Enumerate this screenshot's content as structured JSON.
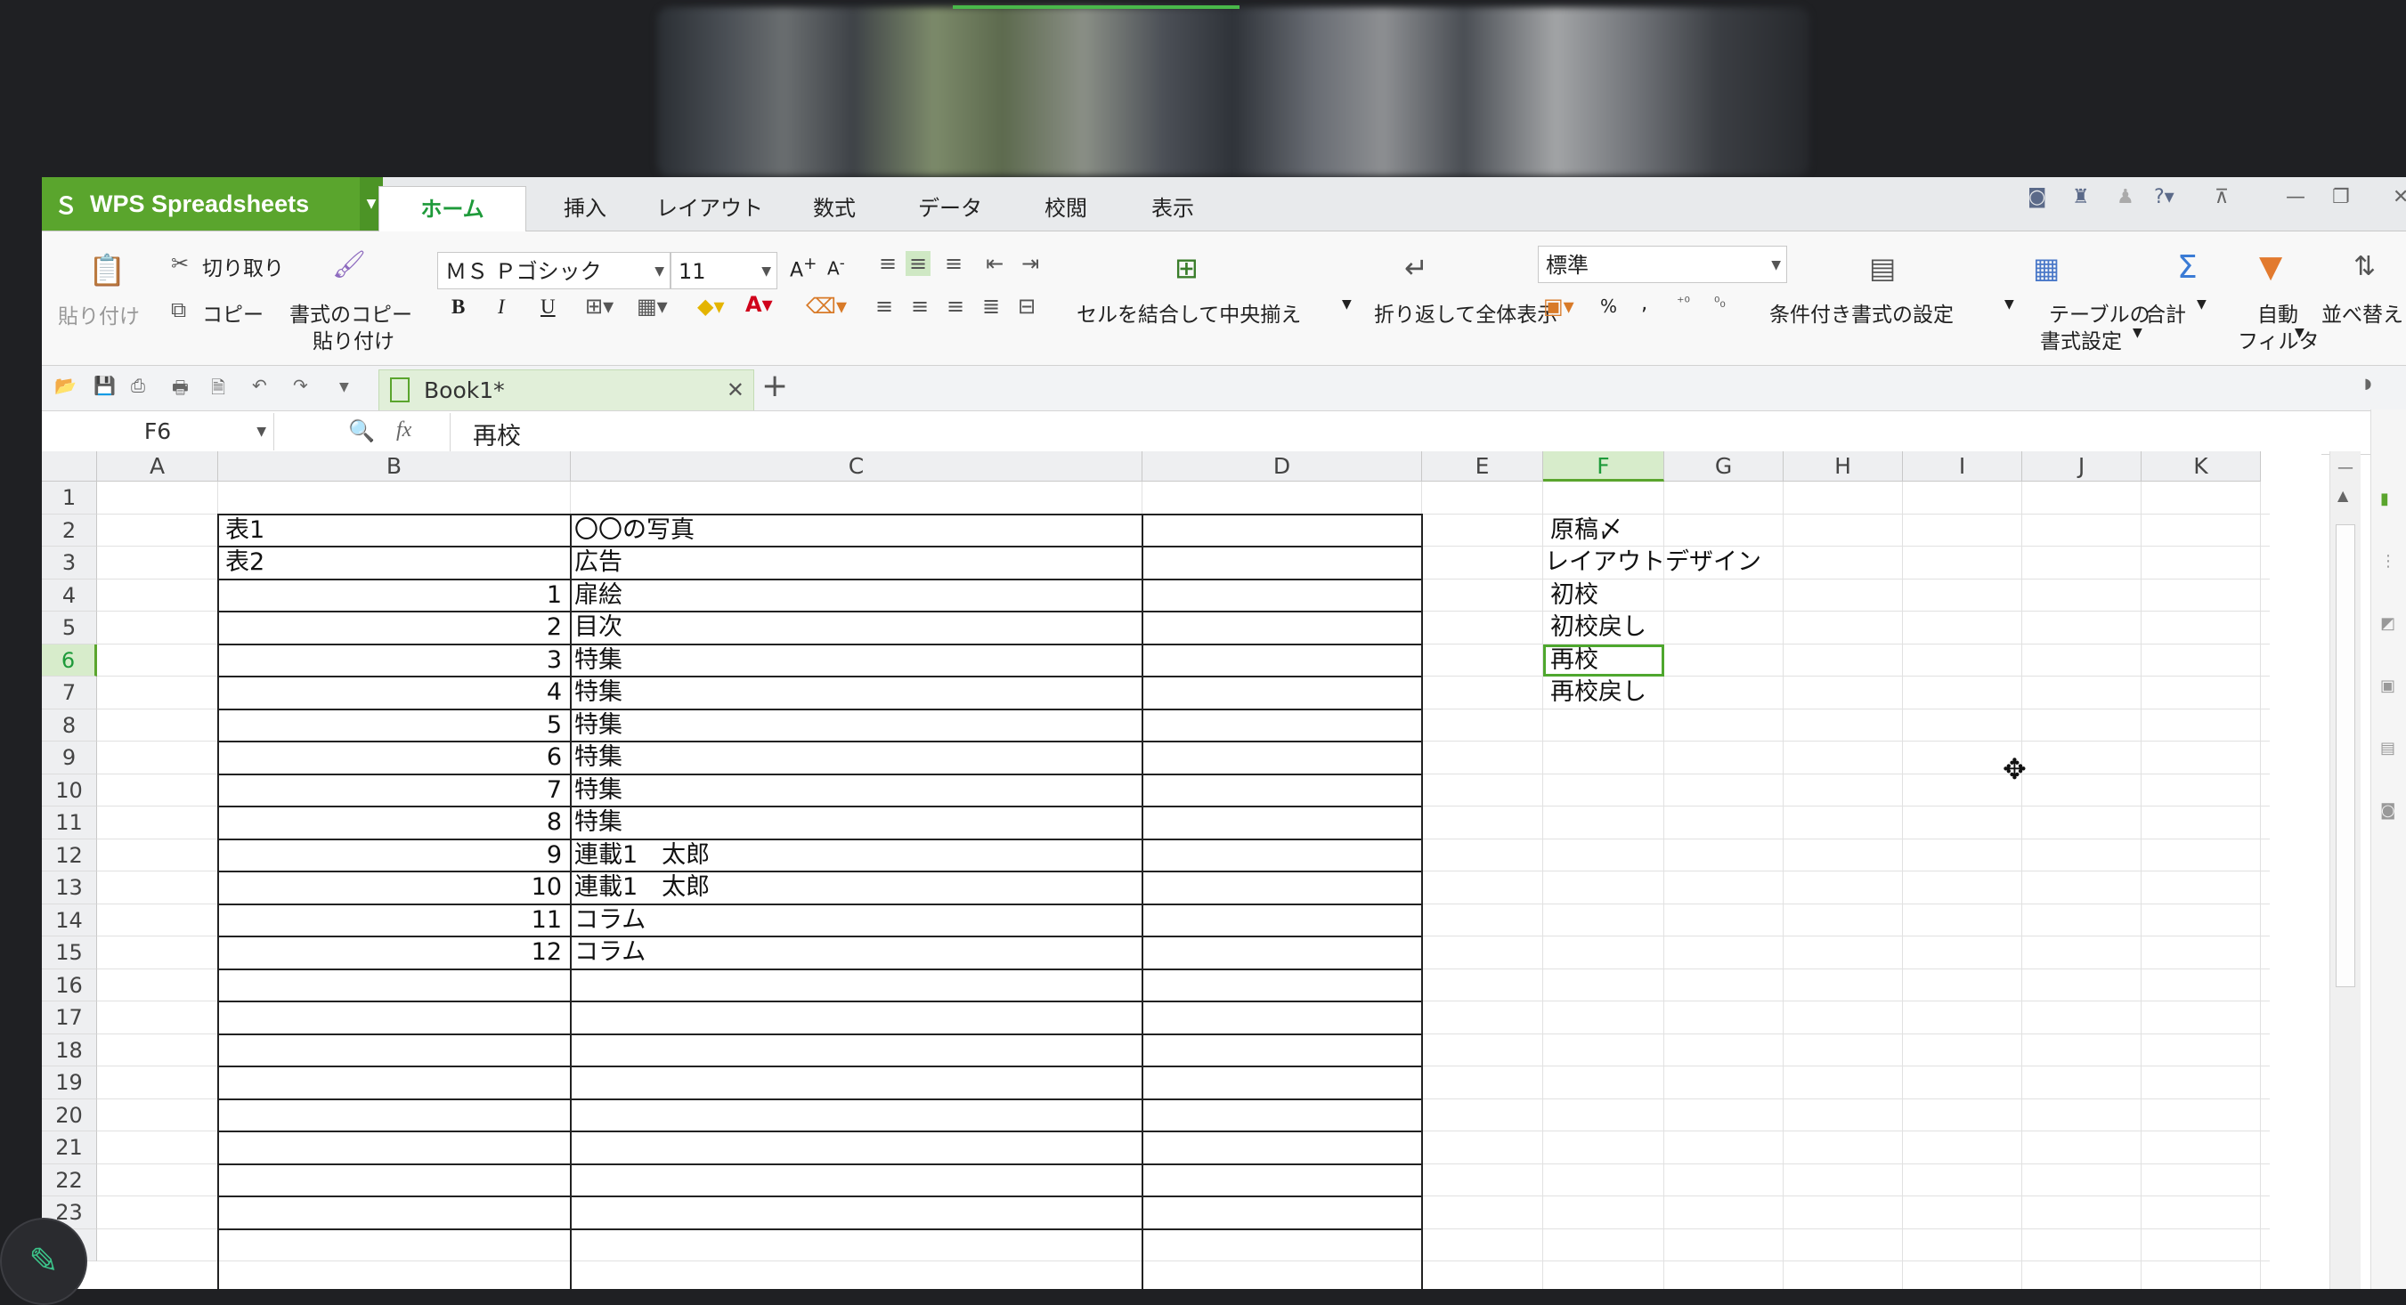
{
  "app": {
    "title": "WPS Spreadsheets",
    "tabs": [
      "ホーム",
      "挿入",
      "レイアウト",
      "数式",
      "データ",
      "校閲",
      "表示"
    ],
    "active_tab": "ホーム",
    "accent": "#5aa52d"
  },
  "ribbon": {
    "paste": "貼り付け",
    "cut": "切り取り",
    "copy": "コピー",
    "format_painter_1": "書式のコピー",
    "format_painter_2": "貼り付け",
    "font_name": "ＭＳ Ｐゴシック",
    "font_size": "11",
    "merge_center": "セルを結合して中央揃え",
    "wrap_text": "折り返して全体表示",
    "number_format": "標準",
    "conditional_format": "条件付き書式の設定",
    "table_format_1": "テーブルの",
    "table_format_2": "書式設定",
    "sum": "合計",
    "autofilter_1": "自動",
    "autofilter_2": "フィルタ",
    "sort": "並べ替え",
    "bold": "B",
    "italic": "I",
    "underline": "U",
    "percent": "%",
    "comma": ","
  },
  "doc": {
    "tab_name": "Book1*"
  },
  "formula_bar": {
    "name_box": "F6",
    "fx": "fx",
    "value": "再校"
  },
  "grid": {
    "columns": [
      "A",
      "B",
      "C",
      "D",
      "E",
      "F",
      "G",
      "H",
      "I",
      "J",
      "K"
    ],
    "selected_column": "F",
    "rows": [
      "1",
      "2",
      "3",
      "4",
      "5",
      "6",
      "7",
      "8",
      "9",
      "10",
      "11",
      "12",
      "13",
      "14",
      "15",
      "16",
      "17",
      "18",
      "19",
      "20",
      "21",
      "22",
      "23",
      "24"
    ],
    "selected_row": "6",
    "table": [
      {
        "b": "表1",
        "c": "〇〇の写真"
      },
      {
        "b": "表2",
        "c": "広告"
      },
      {
        "b": "1",
        "c": "扉絵"
      },
      {
        "b": "2",
        "c": "目次"
      },
      {
        "b": "3",
        "c": "特集"
      },
      {
        "b": "4",
        "c": "特集"
      },
      {
        "b": "5",
        "c": "特集"
      },
      {
        "b": "6",
        "c": "特集"
      },
      {
        "b": "7",
        "c": "特集"
      },
      {
        "b": "8",
        "c": "特集"
      },
      {
        "b": "9",
        "c": "連載1　太郎"
      },
      {
        "b": "10",
        "c": "連載1　太郎"
      },
      {
        "b": "11",
        "c": "コラム"
      },
      {
        "b": "12",
        "c": "コラム"
      }
    ],
    "f_column": [
      "原稿〆",
      "レイアウトデザイン",
      "初校",
      "初校戻し",
      "再校",
      "再校戻し"
    ]
  }
}
